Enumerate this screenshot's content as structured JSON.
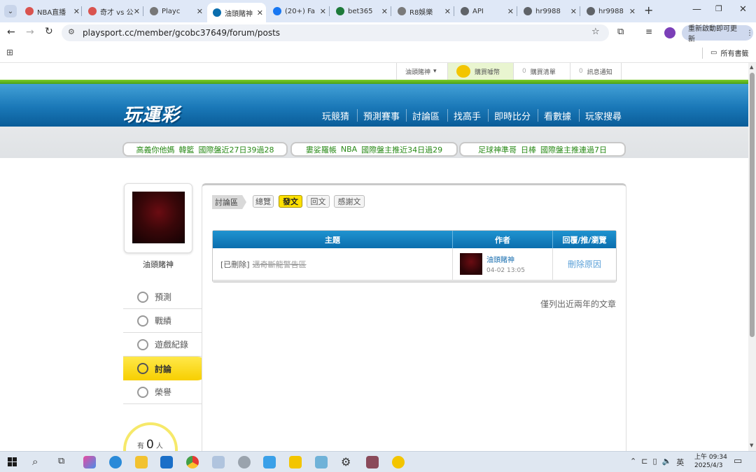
{
  "browser": {
    "tabs": [
      {
        "label": "NBA直播",
        "fav_color": "#d9534f"
      },
      {
        "label": "奇才 vs 公",
        "fav_color": "#d9534f"
      },
      {
        "label": "Playc",
        "fav_color": "#777777"
      },
      {
        "label": "油頭賭神",
        "fav_color": "#0b6eae"
      },
      {
        "label": "(20+) Fa",
        "fav_color": "#1877f2"
      },
      {
        "label": "bet365",
        "fav_color": "#1d7a3a"
      },
      {
        "label": "R8娛樂",
        "fav_color": "#7a7a7a"
      },
      {
        "label": "API",
        "fav_color": "#5f6368"
      },
      {
        "label": "hr9988",
        "fav_color": "#5f6368"
      },
      {
        "label": "hr9988",
        "fav_color": "#5f6368"
      }
    ],
    "url": "playsport.cc/member/gcobc37649/forum/posts",
    "update_button": "重新啟動即可更新",
    "all_bookmarks": "所有書籤"
  },
  "site": {
    "util_bar": {
      "user_menu": "油頭賭神",
      "buy_coins": "購買噱幣",
      "watchlist_count": "0",
      "watchlist": "購買清單",
      "notify_count": "0",
      "notify": "訊息通知"
    },
    "logo": "玩運彩",
    "nav": [
      "玩競猜",
      "預測賽事",
      "討論區",
      "找高手",
      "即時比分",
      "看數據",
      "玩家搜尋"
    ],
    "tickers": [
      {
        "user": "高義你他媽",
        "team": "韓籃",
        "desc": "國際盤近27日39過28"
      },
      {
        "user": "婁娑羅帳",
        "team": "NBA",
        "desc": "國際盤主推近34日過29"
      },
      {
        "user": "足球神準哥",
        "team": "日棒",
        "desc": "國際盤主推連過7日"
      }
    ]
  },
  "profile": {
    "name": "油頭賭神",
    "menu": [
      "預測",
      "戰績",
      "遊戲紀錄",
      "討論",
      "榮譽"
    ],
    "active_index": 3,
    "count_prefix": "有",
    "count": "0",
    "count_suffix": "人"
  },
  "forum": {
    "breadcrumb": "討論區",
    "filters": [
      "總覽",
      "發文",
      "回文",
      "感謝文"
    ],
    "active_filter": 1,
    "columns": [
      "主題",
      "作者",
      "回覆/推/瀏覽"
    ],
    "rows": [
      {
        "tag": "[已刪除]",
        "title": "邁奇斷龍警告區",
        "author": "油頭賭神",
        "date": "04-02 13:05",
        "stats": "刪除原因"
      }
    ],
    "footnote": "僅列出近兩年的文章"
  },
  "taskbar": {
    "ime": "英",
    "time": "上午 09:34",
    "date": "2025/4/3"
  }
}
